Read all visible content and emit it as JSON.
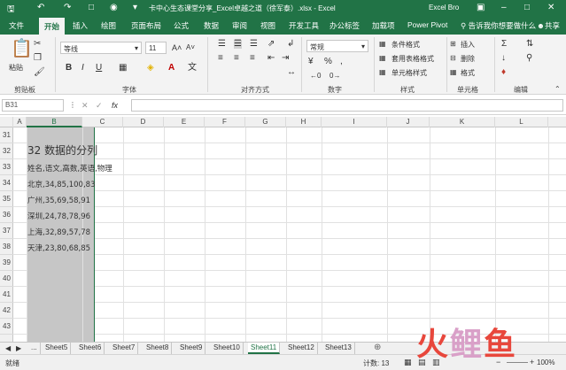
{
  "window": {
    "title": "卡中心生态课堂分享_Excel卓越之道（徐军泰）.xlsx - Excel",
    "user": "Excel Bro",
    "accent": "#217346"
  },
  "tabs": [
    "文件",
    "开始",
    "插入",
    "绘图",
    "页面布局",
    "公式",
    "数据",
    "审阅",
    "视图",
    "开发工具",
    "办公标签",
    "加载项",
    "Power Pivot"
  ],
  "active_tab": "开始",
  "tell_me": "告诉我你想要做什么",
  "share": "共享",
  "ribbon": {
    "clipboard": {
      "paste": "粘贴",
      "label": "剪贴板"
    },
    "font": {
      "name": "等线",
      "size": "11",
      "label": "字体"
    },
    "align": {
      "label": "对齐方式"
    },
    "number": {
      "format": "常规",
      "label": "数字"
    },
    "styles": {
      "cond": "条件格式",
      "table": "套用表格格式",
      "cell": "单元格样式",
      "label": "样式"
    },
    "cells": {
      "insert": "插入",
      "delete": "删除",
      "format": "格式",
      "label": "单元格"
    },
    "edit": {
      "label": "编辑"
    }
  },
  "formula_bar": {
    "name_box": "B31",
    "fx": "fx",
    "value": ""
  },
  "columns": [
    "A",
    "B",
    "C",
    "D",
    "E",
    "F",
    "G",
    "H",
    "I",
    "J",
    "K",
    "L"
  ],
  "selected_column": "B",
  "rows": [
    "31",
    "32",
    "33",
    "34",
    "35",
    "36",
    "37",
    "38",
    "39",
    "40",
    "41",
    "42",
    "43"
  ],
  "cells": {
    "heading": "32 数据的分列",
    "r34": "姓名,语文,高数,英语,物理",
    "r35": "北京,34,85,100,83",
    "r36": "广州,35,69,58,91",
    "r37": "深圳,24,78,78,96",
    "r38": "上海,32,89,57,78",
    "r39": "天津,23,80,68,85"
  },
  "sheets": [
    "...",
    "Sheet5",
    "Sheet6",
    "Sheet7",
    "Sheet8",
    "Sheet9",
    "Sheet10",
    "Sheet11",
    "Sheet12",
    "Sheet13"
  ],
  "active_sheet": "Sheet11",
  "status": {
    "mode": "就绪",
    "count_label": "计数: 13",
    "zoom": "100%"
  },
  "watermark": "火鲤鱼"
}
